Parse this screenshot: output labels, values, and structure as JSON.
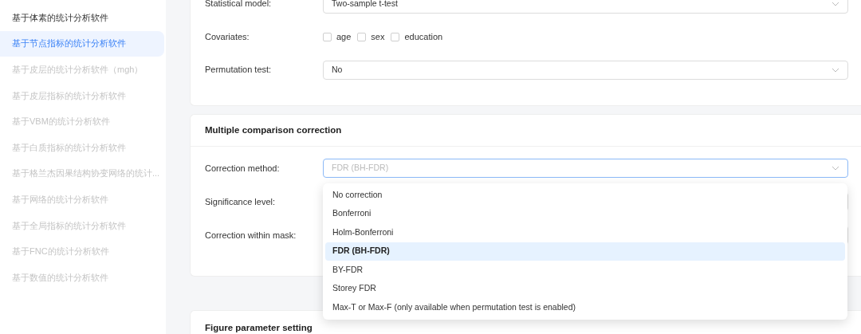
{
  "sidebar": {
    "items": [
      {
        "label": "基于体素的统计分析软件",
        "selected": false,
        "disabled": false
      },
      {
        "label": "基于节点指标的统计分析软件",
        "selected": true,
        "disabled": false
      },
      {
        "label": "基于皮层的统计分析软件（mgh）",
        "selected": false,
        "disabled": true
      },
      {
        "label": "基于皮层指标的统计分析软件",
        "selected": false,
        "disabled": true
      },
      {
        "label": "基于VBM的统计分析软件",
        "selected": false,
        "disabled": true
      },
      {
        "label": "基于白质指标的统计分析软件",
        "selected": false,
        "disabled": true
      },
      {
        "label": "基于格兰杰因果结构协变网络的统计...",
        "selected": false,
        "disabled": true
      },
      {
        "label": "基于网络的统计分析软件",
        "selected": false,
        "disabled": true
      },
      {
        "label": "基于全局指标的统计分析软件",
        "selected": false,
        "disabled": true
      },
      {
        "label": "基于FNC的统计分析软件",
        "selected": false,
        "disabled": true
      },
      {
        "label": "基于数值的统计分析软件",
        "selected": false,
        "disabled": true
      }
    ]
  },
  "model_card": {
    "rows": [
      {
        "kind": "select",
        "label": "Statistical model:",
        "value": "Two-sample t-test"
      },
      {
        "kind": "checkboxes",
        "label": "Covariates:",
        "options": [
          {
            "label": "age",
            "checked": false
          },
          {
            "label": "sex",
            "checked": false
          },
          {
            "label": "education",
            "checked": false
          }
        ]
      },
      {
        "kind": "select",
        "label": "Permutation test:",
        "value": "No"
      }
    ]
  },
  "correction_card": {
    "title": "Multiple comparison correction",
    "rows": [
      {
        "kind": "select",
        "label": "Correction method:",
        "placeholder": "FDR (BH-FDR)",
        "open": true
      },
      {
        "kind": "select",
        "label": "Significance level:"
      },
      {
        "kind": "select",
        "label": "Correction within mask:"
      }
    ],
    "dropdown": [
      {
        "label": "No correction",
        "selected": false
      },
      {
        "label": "Bonferroni",
        "selected": false
      },
      {
        "label": "Holm-Bonferroni",
        "selected": false
      },
      {
        "label": "FDR (BH-FDR)",
        "selected": true
      },
      {
        "label": "BY-FDR",
        "selected": false
      },
      {
        "label": "Storey FDR",
        "selected": false
      },
      {
        "label": "Max-T or Max-F (only available when permutation test is enabled)",
        "selected": false
      }
    ]
  },
  "figure_card": {
    "title": "Figure parameter setting"
  }
}
